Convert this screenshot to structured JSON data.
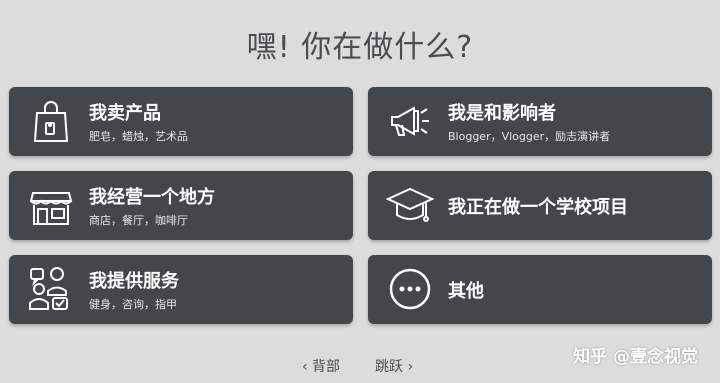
{
  "title": "嘿! 你在做什么?",
  "cards": [
    {
      "label": "我卖产品",
      "sub": "肥皂，蜡烛，艺术品",
      "icon": "shopping-bag-icon"
    },
    {
      "label": "我是和影响者",
      "sub": "Blogger，Vlogger，励志演讲者",
      "icon": "megaphone-icon"
    },
    {
      "label": "我经营一个地方",
      "sub": "商店，餐厅，咖啡厅",
      "icon": "storefront-icon"
    },
    {
      "label": "我正在做一个学校项目",
      "sub": "",
      "icon": "graduation-cap-icon"
    },
    {
      "label": "我提供服务",
      "sub": "健身，咨询，指甲",
      "icon": "people-service-icon"
    },
    {
      "label": "其他",
      "sub": "",
      "icon": "more-icon"
    }
  ],
  "nav": {
    "back": "‹ 背部",
    "skip": "跳跃 ›"
  },
  "watermark": "知乎 @壹念视觉"
}
